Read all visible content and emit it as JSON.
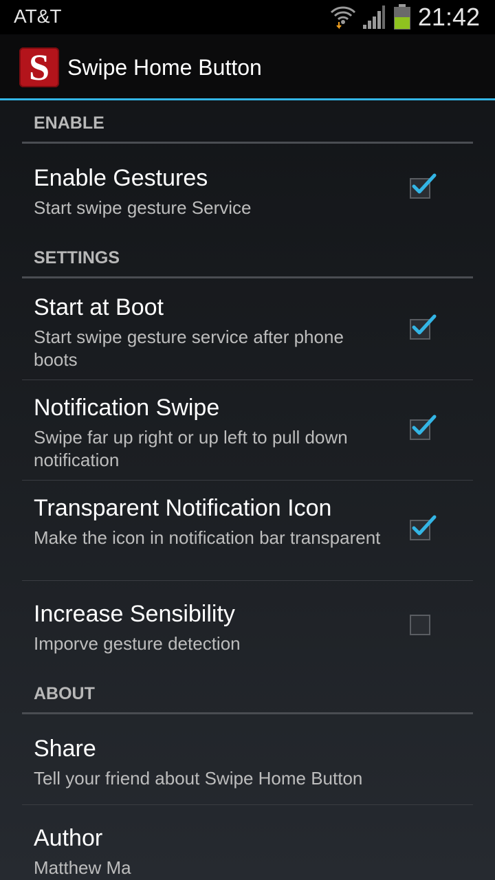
{
  "status_bar": {
    "carrier": "AT&T",
    "time": "21:42"
  },
  "action_bar": {
    "icon_letter": "S",
    "title": "Swipe Home Button"
  },
  "sections": {
    "enable": {
      "header": "ENABLE",
      "items": [
        {
          "title": "Enable Gestures",
          "summary": "Start swipe gesture Service",
          "checked": true
        }
      ]
    },
    "settings": {
      "header": "SETTINGS",
      "items": [
        {
          "title": "Start at Boot",
          "summary": "Start swipe gesture service after phone boots",
          "checked": true
        },
        {
          "title": "Notification Swipe",
          "summary": "Swipe far up right or up left to pull down notification",
          "checked": true
        },
        {
          "title": "Transparent Notification Icon",
          "summary": "Make the icon in notification bar transparent",
          "checked": true
        },
        {
          "title": "Increase Sensibility",
          "summary": "Imporve gesture detection",
          "checked": false
        }
      ]
    },
    "about": {
      "header": "ABOUT",
      "items": [
        {
          "title": "Share",
          "summary": "Tell your friend about Swipe Home Button"
        },
        {
          "title": "Author",
          "summary": "Matthew Ma"
        }
      ]
    }
  },
  "colors": {
    "accent": "#33b5e5",
    "check": "#33b5e5",
    "app_icon": "#b3141b"
  },
  "icons": {
    "wifi": "wifi-icon",
    "signal": "signal-icon",
    "battery": "battery-icon",
    "check": "check-icon"
  }
}
